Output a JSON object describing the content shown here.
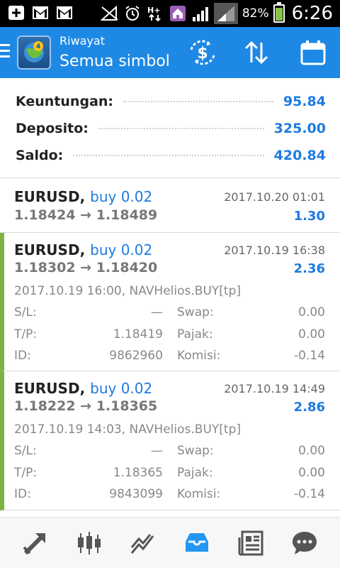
{
  "status_bar": {
    "battery_percent": "82%",
    "time": "6:26",
    "battery_level": 0.82,
    "icons": [
      "add-icon",
      "gmail-icon",
      "gmail-icon",
      "signal-muted-icon",
      "alarm-icon",
      "data-arrows-icon",
      "home-icon",
      "signal-bars-icon",
      "signal-bars-icon"
    ]
  },
  "header": {
    "subtitle": "Riwayat",
    "title": "Semua simbol",
    "actions": [
      "currency-exchange-icon",
      "sort-icon",
      "calendar-icon"
    ]
  },
  "summary": [
    {
      "label": "Keuntungan:",
      "value": "95.84"
    },
    {
      "label": "Deposito:",
      "value": "325.00"
    },
    {
      "label": "Saldo:",
      "value": "420.84"
    }
  ],
  "entries": [
    {
      "symbol": "EURUSD",
      "type": "buy 0.02",
      "date": "2017.10.20 01:01",
      "prices": "1.18424 → 1.18489",
      "profit": "1.30"
    },
    {
      "symbol": "EURUSD",
      "type": "buy 0.02",
      "date": "2017.10.19 16:38",
      "prices": "1.18302 → 1.18420",
      "profit": "2.36",
      "comment": "2017.10.19 16:00, NAVHelios.BUY[tp]",
      "sl_label": "S/L:",
      "sl": "—",
      "tp_label": "T/P:",
      "tp": "1.18419",
      "id_label": "ID:",
      "id": "9862960",
      "swap_label": "Swap:",
      "swap": "0.00",
      "tax_label": "Pajak:",
      "tax": "0.00",
      "fee_label": "Komisi:",
      "fee": "-0.14"
    },
    {
      "symbol": "EURUSD",
      "type": "buy 0.02",
      "date": "2017.10.19 14:49",
      "prices": "1.18222 → 1.18365",
      "profit": "2.86",
      "comment": "2017.10.19 14:03, NAVHelios.BUY[tp]",
      "sl_label": "S/L:",
      "sl": "—",
      "tp_label": "T/P:",
      "tp": "1.18365",
      "id_label": "ID:",
      "id": "9843099",
      "swap_label": "Swap:",
      "swap": "0.00",
      "tax_label": "Pajak:",
      "tax": "0.00",
      "fee_label": "Komisi:",
      "fee": "-0.14"
    }
  ],
  "bottom_nav": [
    "trade-icon",
    "chart-candles-icon",
    "trend-icon",
    "history-inbox-icon",
    "news-icon",
    "chat-icon"
  ],
  "colors": {
    "accent": "#1e88e5",
    "value_blue": "#1e7be0",
    "active_border": "#7cb342",
    "active_nav": "#2196f3"
  }
}
